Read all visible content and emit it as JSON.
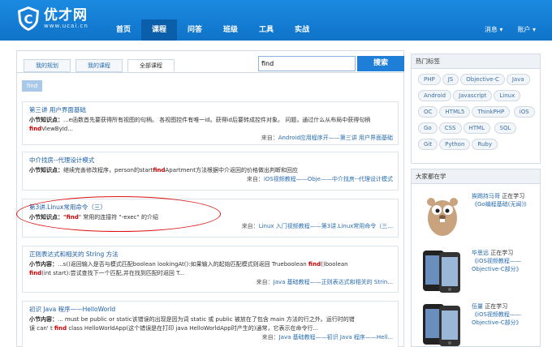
{
  "brand": {
    "name": "优才网",
    "url": "www.ucai.cn"
  },
  "nav": {
    "items": [
      {
        "label": "首页"
      },
      {
        "label": "课程"
      },
      {
        "label": "问答"
      },
      {
        "label": "班级"
      },
      {
        "label": "工具"
      },
      {
        "label": "实战"
      }
    ],
    "right": [
      {
        "label": "消息 ▾"
      },
      {
        "label": "账户 ▾"
      }
    ]
  },
  "tabs": [
    {
      "label": "我的规划"
    },
    {
      "label": "我的课程"
    },
    {
      "label": "全部课程"
    }
  ],
  "search": {
    "value": "find",
    "button": "搜索"
  },
  "active_filter": "find",
  "results": [
    {
      "title": "第三讲 用户界面基础",
      "label": "小节知识点：",
      "body_pre": "...e函数首先要获得所有视图的句柄。 各视图控件有唯一id。获得id后要转成控件对象。 问题，通过什么从布局中获得句柄 ",
      "hl": "find",
      "body_post": "ViewById...",
      "src_prefix": "来自：",
      "src": "Android应用程序开——第三讲 用户界面基础"
    },
    {
      "title": "中介找房--代理设计模式",
      "label": "小节知识点：",
      "body_pre": "继续完善修改程序，person的start",
      "hl": "find",
      "body_post": "Apartment方法根据中介返回的价格做出判断和回应",
      "src_prefix": "来自：",
      "src": "iOS视频教程——Obje——中介找房--代理设计模式"
    },
    {
      "title": "第3讲.Linux常用命令（三）",
      "label": "小节知识点：",
      "body_pre": "\"",
      "hl": "find",
      "body_post": "\" 常用的连接符 \"-exec\" 的介绍",
      "src_prefix": "来自：",
      "src": "Linux 入门视频教程——第3讲.Linux常用命令（三..."
    },
    {
      "title": "正则表达式和相关的 String 方法",
      "label": "小节内容：",
      "line1_pre": "...s()返回输入是否与模式匹配boolean lookingAt():如果输入的起始匹配模式则返回 Trueboolean ",
      "line1_hl": "find",
      "line1_post": "()boolean",
      "line2_hl": "find",
      "line2_post": "(int start):尝试查找下一个匹配,并在找到匹配时返回 T...",
      "src_prefix": "来自：",
      "src": "Java 基础教程——正则表达式和相关的 Strin..."
    },
    {
      "title": "初识 Java 程序——HelloWorld",
      "label": "小节内容：",
      "line1_pre": "... must be public or static该错误的出现是因为词 static 或 public 被放在了包含 main 方法的行之外。运行时的错",
      "line2_pre": "误 can' t ",
      "line2_hl": "find",
      "line2_post": " class HelloWorldApp(这个错误是在打印 java HelloWorldApp时产生的)通常，它表示在命令行...",
      "src_prefix": "来自：",
      "src": "Java 基础教程——初识 Java 程序——Hell..."
    }
  ],
  "sidebar": {
    "popular_tags_title": "热门标签",
    "tags": [
      "PHP",
      "JS",
      "Objective-C",
      "Java",
      "Android",
      "Javascript",
      "Linux",
      "OC",
      "HTML5",
      "ThinkPHP",
      "iOS",
      "Go",
      "CSS",
      "HTML",
      "SQL",
      "Git",
      "Python",
      "Ruby"
    ],
    "learning_title": "大家都在学",
    "learners": [
      {
        "user": "挨踢持马哥",
        "action": " 正在学习",
        "course": "《Go编程基础(无闻)》"
      },
      {
        "user": "毕思远",
        "action": " 正在学习",
        "course": "《iOS视频教程——Objective-C部分》"
      },
      {
        "user": "伍量",
        "action": " 正在学习",
        "course": "《iOS视频教程——Objective-C部分》"
      }
    ]
  },
  "colors": {
    "header": "#1581d8",
    "link": "#1a5ea8",
    "highlight": "#cc0000",
    "annotation": "#dd1111"
  }
}
